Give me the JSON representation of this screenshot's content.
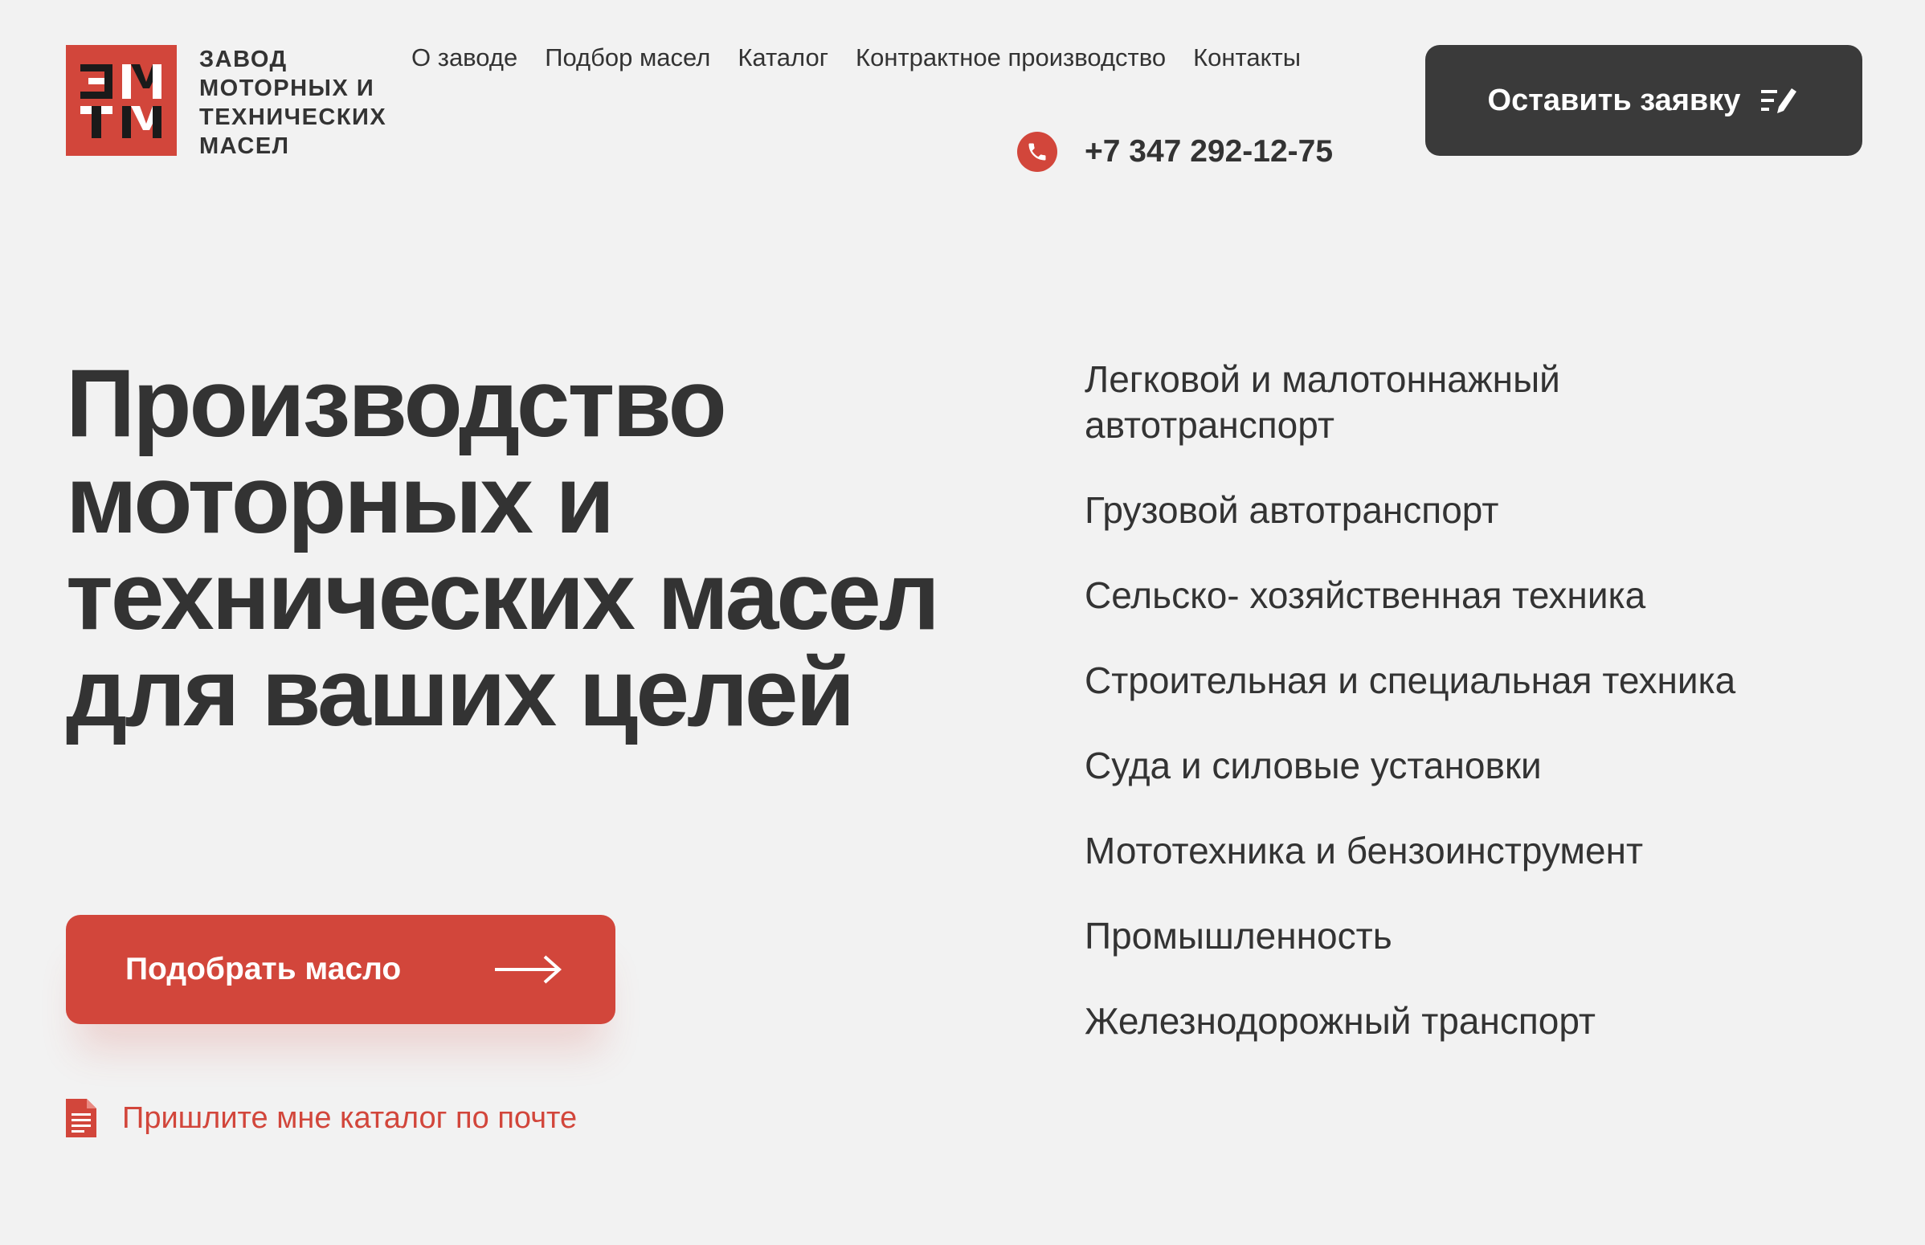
{
  "brand": {
    "name_lines": [
      "ЗАВОД",
      "МОТОРНЫХ И",
      "ТЕХНИЧЕСКИХ",
      "МАСЕЛ"
    ],
    "logo_letters": "ЗМТМ",
    "brand_color": "#d2463b",
    "dark_color": "#3a3a3a",
    "text_color": "#333333",
    "background_color": "#f2f2f2"
  },
  "nav": {
    "items": [
      {
        "label": "О заводе"
      },
      {
        "label": "Подбор масел"
      },
      {
        "label": "Каталог"
      },
      {
        "label": "Контрактное производство"
      },
      {
        "label": "Контакты"
      }
    ]
  },
  "contact": {
    "phone": "+7 347 292-12-75",
    "phone_icon": "phone-icon"
  },
  "header_button": {
    "label": "Оставить заявку",
    "icon": "form-edit-icon"
  },
  "hero": {
    "title": "Производство моторных и технических масел для ваших целей",
    "cta_label": "Подобрать масло",
    "cta_icon": "arrow-right-icon",
    "catalog_link": "Пришлите мне каталог по почте",
    "catalog_icon": "document-icon"
  },
  "categories": [
    {
      "label": "Легковой и малотоннажный автотранспорт"
    },
    {
      "label": "Грузовой автотранспорт"
    },
    {
      "label": "Сельско- хозяйственная техника"
    },
    {
      "label": "Строительная и специальная техника"
    },
    {
      "label": "Суда и силовые установки"
    },
    {
      "label": "Мототехника и бензоинструмент"
    },
    {
      "label": "Промышленность"
    },
    {
      "label": "Железнодорожный транспорт"
    }
  ]
}
